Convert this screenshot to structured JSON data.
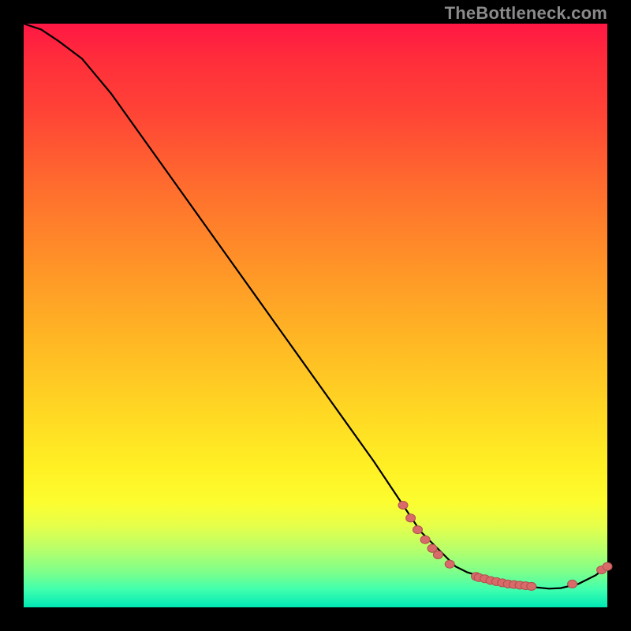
{
  "watermark": "TheBottleneck.com",
  "colors": {
    "line": "#000000",
    "marker_fill": "#d86a6a",
    "marker_stroke": "#b24e4e"
  },
  "chart_data": {
    "type": "line",
    "title": "",
    "xlabel": "",
    "ylabel": "",
    "xlim": [
      0,
      100
    ],
    "ylim": [
      0,
      100
    ],
    "x": [
      0,
      3,
      6,
      10,
      15,
      20,
      25,
      30,
      35,
      40,
      45,
      50,
      55,
      60,
      64,
      66,
      68,
      70,
      72,
      74,
      75,
      76,
      77,
      78,
      79,
      80,
      81,
      82,
      83,
      84,
      85,
      86,
      88,
      90,
      92,
      95,
      98,
      100
    ],
    "y": [
      100,
      99,
      97,
      94,
      88,
      81,
      74,
      67,
      60,
      53,
      46,
      39,
      32,
      25,
      19,
      16,
      13,
      11,
      9,
      7,
      6.5,
      6.0,
      5.7,
      5.4,
      5.1,
      4.9,
      4.7,
      4.5,
      4.3,
      4.1,
      3.9,
      3.7,
      3.4,
      3.2,
      3.3,
      4.0,
      5.5,
      7.0
    ],
    "markers": [
      {
        "x": 65.0,
        "y": 17.5
      },
      {
        "x": 66.3,
        "y": 15.3
      },
      {
        "x": 67.5,
        "y": 13.3
      },
      {
        "x": 68.8,
        "y": 11.6
      },
      {
        "x": 70.0,
        "y": 10.1
      },
      {
        "x": 71.0,
        "y": 9.0
      },
      {
        "x": 73.0,
        "y": 7.4
      },
      {
        "x": 77.5,
        "y": 5.3
      },
      {
        "x": 78.0,
        "y": 5.1
      },
      {
        "x": 79.0,
        "y": 4.9
      },
      {
        "x": 80.0,
        "y": 4.6
      },
      {
        "x": 81.0,
        "y": 4.4
      },
      {
        "x": 82.0,
        "y": 4.2
      },
      {
        "x": 83.0,
        "y": 4.0
      },
      {
        "x": 84.0,
        "y": 3.9
      },
      {
        "x": 85.0,
        "y": 3.8
      },
      {
        "x": 86.0,
        "y": 3.7
      },
      {
        "x": 87.0,
        "y": 3.6
      },
      {
        "x": 94.0,
        "y": 4.0
      },
      {
        "x": 99.0,
        "y": 6.4
      },
      {
        "x": 100.0,
        "y": 7.0
      }
    ]
  }
}
